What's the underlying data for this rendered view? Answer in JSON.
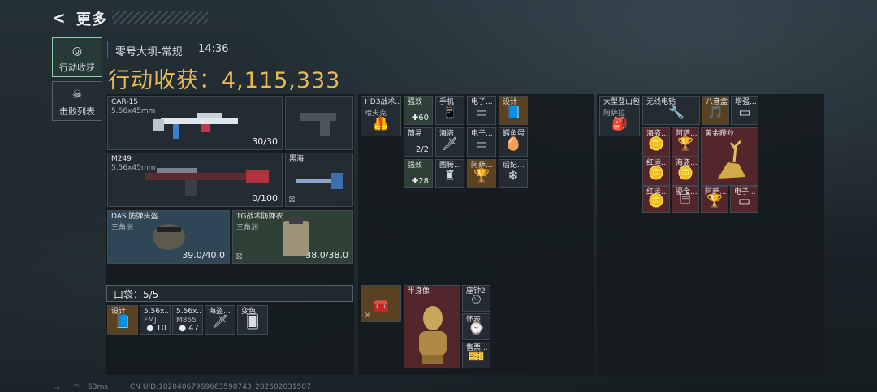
{
  "header": {
    "back_glyph": "<",
    "title": "更多"
  },
  "tabs": [
    {
      "label": "行动收获",
      "icon": "target-icon"
    },
    {
      "label": "击败列表",
      "icon": "skull-icon"
    }
  ],
  "raid": {
    "map": "零号大坝-常规",
    "time": "14:36",
    "total_label": "行动收获：",
    "total_value": "4,115,333"
  },
  "loadout": {
    "primary": {
      "name": "CAR-15",
      "ammo": "5.56x45mm",
      "count": "30/30"
    },
    "secondary": {
      "name": "M249",
      "ammo": "5.56x45mm",
      "count": "0/100"
    },
    "melee": {
      "name": "黑海"
    },
    "helmet": {
      "name": "DAS 防弹头盔",
      "origin": "三角洲",
      "durability": "39.0/40.0"
    },
    "armor": {
      "name": "TG战术防弹衣",
      "origin": "三角洲",
      "durability": "38.0/38.0"
    }
  },
  "pocket": {
    "label": "口袋：5/5",
    "items": [
      {
        "name": "设计",
        "count": ""
      },
      {
        "name": "5.56x...",
        "sub": "FMJ",
        "count": "10"
      },
      {
        "name": "5.56x...",
        "sub": "M855",
        "count": "47"
      },
      {
        "name": "海盗...",
        "count": ""
      },
      {
        "name": "变色",
        "count": ""
      }
    ]
  },
  "chest_rig": {
    "name": "HD3战术...",
    "sub": "哈夫克",
    "items": [
      {
        "name": "强效",
        "count": "60"
      },
      {
        "name": "手机",
        "count": ""
      },
      {
        "name": "电子...",
        "count": ""
      },
      {
        "name": "设计",
        "count": ""
      },
      {
        "name": "简易",
        "count": "2/2"
      },
      {
        "name": "海盗",
        "count": ""
      },
      {
        "name": "电子...",
        "count": ""
      },
      {
        "name": "鳄鱼蛋",
        "count": ""
      },
      {
        "name": "强效",
        "count": "28"
      },
      {
        "name": "图腾...",
        "count": ""
      },
      {
        "name": "阿萨...",
        "count": ""
      },
      {
        "name": "后妃...",
        "count": ""
      }
    ]
  },
  "backpack": {
    "name": "大型登山包",
    "sub": "阿萨拉",
    "items": [
      {
        "name": "无线电钻"
      },
      {
        "name": "八音盒"
      },
      {
        "name": "增强..."
      },
      {
        "name": "海盗..."
      },
      {
        "name": "阿萨..."
      },
      {
        "name": "黄金瞪羚"
      },
      {
        "name": "红运..."
      },
      {
        "name": "海盗..."
      },
      {
        "name": "红运..."
      },
      {
        "name": "鎏金..."
      },
      {
        "name": "阿萨..."
      },
      {
        "name": "电子..."
      }
    ]
  },
  "safe_box": {
    "items": [
      {
        "name": "半身像"
      },
      {
        "name": "座钟2"
      },
      {
        "name": "怀表"
      },
      {
        "name": "售票..."
      }
    ]
  },
  "status_bar": {
    "ping": "63ms",
    "uid": "CN UID:18204067969663598743_202602031507"
  }
}
